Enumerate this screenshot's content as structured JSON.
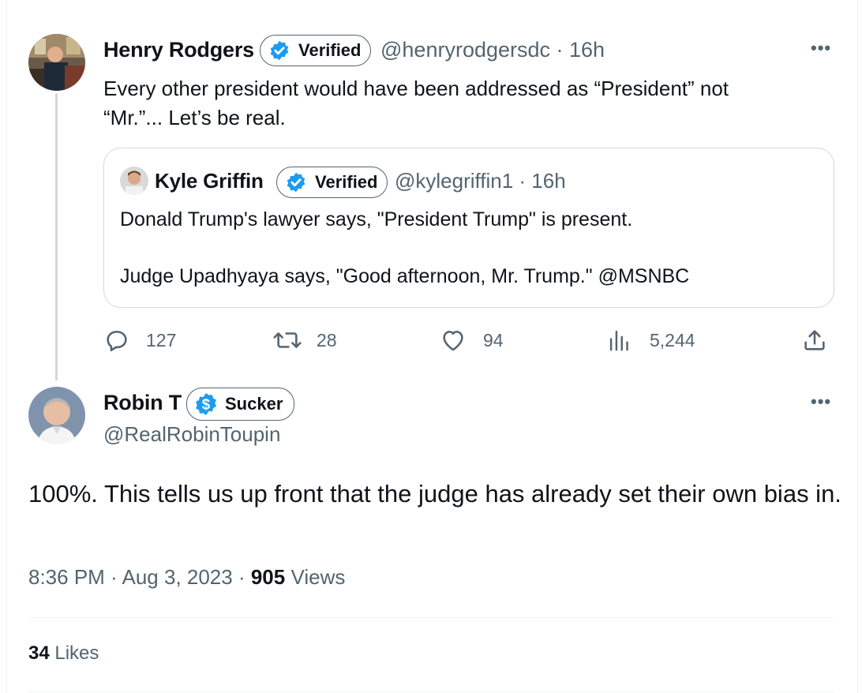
{
  "tweet": {
    "author_name": "Henry Rodgers",
    "badge_label": "Verified",
    "handle_time": "@henryrodgersdc · 16h",
    "text_line1": "Every other president would have been addressed as “President” not",
    "text_line2": "“Mr.”... Let’s be real.",
    "quote": {
      "author_name": "Kyle Griffin",
      "badge_label": "Verified",
      "handle_time": "@kylegriffin1 · 16h",
      "line1": "Donald Trump's lawyer says, \"President Trump\" is present.",
      "line2": "Judge Upadhyaya says, \"Good afternoon, Mr. Trump.\" @MSNBC"
    },
    "actions": {
      "replies": "127",
      "reposts": "28",
      "likes": "94",
      "views": "5,244"
    }
  },
  "reply": {
    "author_name": "Robin T",
    "badge_label": "Sucker",
    "handle": "@RealRobinToupin",
    "text": "100%.  This tells us up front that the judge has already set their own bias in.",
    "timestamp": "8:36 PM · Aug 3, 2023 · ",
    "views_count": "905",
    "views_label": " Views",
    "likes_count": "34",
    "likes_label": " Likes"
  },
  "icons": {
    "more": "more-dots-icon",
    "reply": "reply-icon",
    "repost": "repost-icon",
    "like": "heart-icon",
    "views": "views-icon",
    "share": "share-icon",
    "verified": "verified-check-icon",
    "dollar": "dollar-icon"
  },
  "colors": {
    "verified_blue": "#1d9bf0",
    "secondary_text": "#536471",
    "primary_text": "#0f1419"
  }
}
